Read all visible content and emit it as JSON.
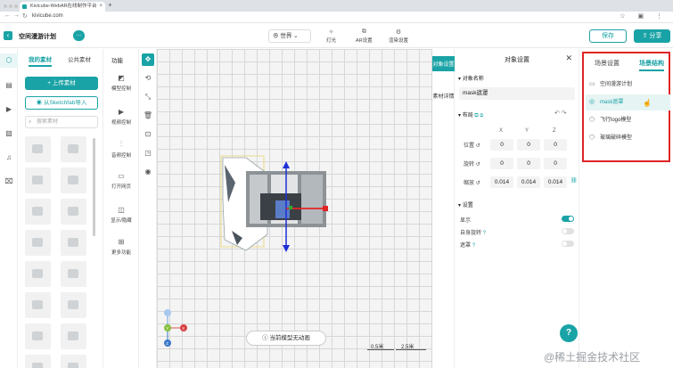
{
  "browser": {
    "tab_title": "Kivicube-WebAR在线制作平台",
    "url": "kivicube.com"
  },
  "appbar": {
    "project_title": "空间漫游计划",
    "world_select": "世界",
    "tools": [
      "灯光",
      "AR设置",
      "渲染设置"
    ],
    "save_label": "保存",
    "share_label": "分享"
  },
  "assets": {
    "tabs": [
      "我的素材",
      "公共素材"
    ],
    "upload_label": "上传素材",
    "sketchfab_label": "从Sketchfab导入",
    "search_placeholder": "搜索素材"
  },
  "functions": {
    "title": "功能",
    "items": [
      "模型控制",
      "视频控制",
      "音频控制",
      "打开网页",
      "显示/隐藏",
      "更多功能"
    ]
  },
  "canvas": {
    "animation_status": "当前模型无动画",
    "scale_labels": [
      "0.5米",
      "2.5米"
    ],
    "gizmo_labels": [
      "X",
      "Y",
      "Z"
    ]
  },
  "props_tabs": [
    "对象设置",
    "素材详情"
  ],
  "object_settings": {
    "title": "对象设置",
    "name_section": "对象名称",
    "name_value": "mask遮罩",
    "layout_section": "布局",
    "axes": [
      "X",
      "Y",
      "Z"
    ],
    "position_label": "位置",
    "position": [
      "0",
      "0",
      "0"
    ],
    "rotation_label": "旋转",
    "rotation": [
      "0",
      "0",
      "0"
    ],
    "scale_label": "缩放",
    "scale": [
      "0.014",
      "0.014",
      "0.014"
    ],
    "settings_section": "设置",
    "toggles": [
      {
        "label": "显示",
        "on": true
      },
      {
        "label": "自身旋转",
        "on": false
      },
      {
        "label": "遮罩",
        "on": false
      }
    ]
  },
  "scene": {
    "tabs": [
      "场景设置",
      "场景结构"
    ],
    "items": [
      "空间漫游计划",
      "mask遮罩",
      "飞行logo模型",
      "玻璃破碎模型"
    ]
  },
  "watermark": "@稀土掘金技术社区",
  "colors": {
    "accent": "#1aa3a6",
    "highlight_box": "#e02424"
  }
}
